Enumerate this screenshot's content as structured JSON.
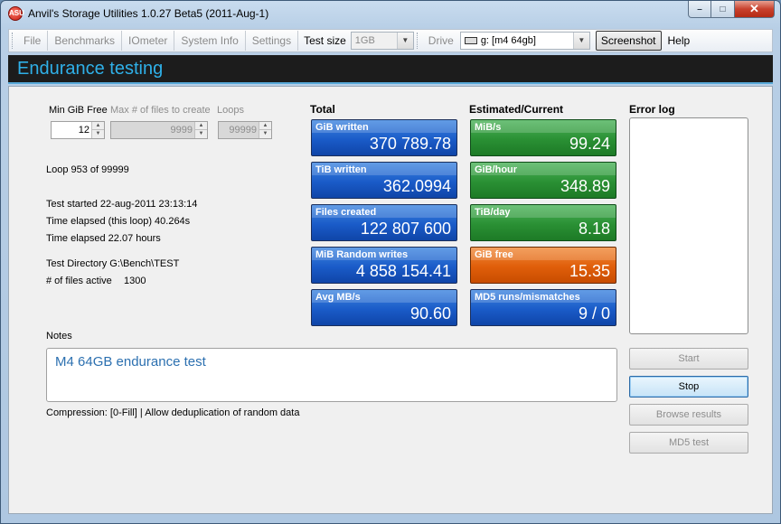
{
  "window": {
    "title": "Anvil's Storage Utilities 1.0.27 Beta5 (2011-Aug-1)",
    "app_icon_text": "ASU"
  },
  "caption": {
    "minimize": "–",
    "maximize": "□",
    "close": "✕"
  },
  "menu": {
    "file": "File",
    "benchmarks": "Benchmarks",
    "iometer": "IOmeter",
    "system_info": "System Info",
    "settings": "Settings",
    "test_size_label": "Test size",
    "test_size_value": "1GB",
    "drive_label": "Drive",
    "drive_value": "g: [m4 64gb]",
    "screenshot": "Screenshot",
    "help": "Help"
  },
  "header": {
    "title": "Endurance testing"
  },
  "params": {
    "min_gib_free_label": "Min GiB Free",
    "min_gib_free_value": "12",
    "max_files_label": "Max # of files to create",
    "max_files_value": "9999",
    "loops_label": "Loops",
    "loops_value": "99999"
  },
  "info": {
    "loop": "Loop 953 of 99999",
    "test_started": "Test started 22-aug-2011 23:13:14",
    "elapsed_loop": "Time elapsed (this loop) 40.264s",
    "elapsed_total": "Time elapsed 22.07 hours",
    "test_directory": "Test Directory G:\\Bench\\TEST",
    "files_active_label": "# of files active",
    "files_active_value": "1300"
  },
  "totals": {
    "heading": "Total",
    "tiles": [
      {
        "label": "GiB written",
        "value": "370 789.78"
      },
      {
        "label": "TiB written",
        "value": "362.0994"
      },
      {
        "label": "Files created",
        "value": "122 807 600"
      },
      {
        "label": "MiB Random writes",
        "value": "4 858 154.41"
      },
      {
        "label": "Avg MB/s",
        "value": "90.60"
      }
    ]
  },
  "estimated": {
    "heading": "Estimated/Current",
    "tiles": [
      {
        "label": "MiB/s",
        "value": "99.24"
      },
      {
        "label": "GiB/hour",
        "value": "348.89"
      },
      {
        "label": "TiB/day",
        "value": "8.18"
      },
      {
        "label": "GiB free",
        "value": "15.35"
      },
      {
        "label": "MD5 runs/mismatches",
        "value": "9 / 0"
      }
    ]
  },
  "error_log": {
    "heading": "Error log"
  },
  "buttons": {
    "start": "Start",
    "stop": "Stop",
    "browse_results": "Browse results",
    "md5_test": "MD5 test"
  },
  "notes": {
    "label": "Notes",
    "text": "M4 64GB endurance test"
  },
  "compression": "Compression: [0-Fill]  |  Allow deduplication of random data",
  "colors": {
    "tile_blue": "#1a5bc8",
    "tile_green": "#2a9034",
    "tile_orange": "#e05e0a",
    "header_text": "#2fb0e8"
  }
}
